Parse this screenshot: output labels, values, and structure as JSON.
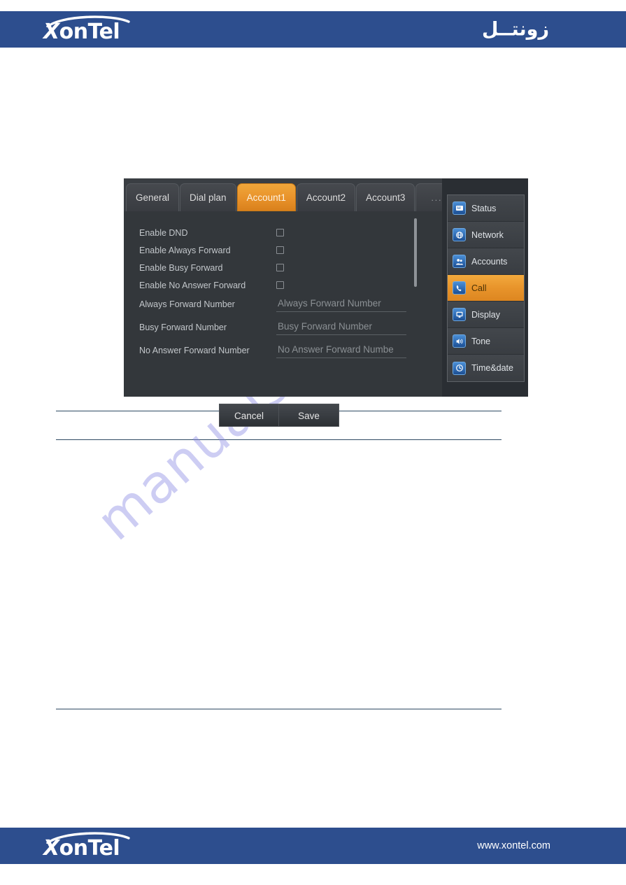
{
  "header": {
    "logo_text_x": "X",
    "logo_text_rest": "onTel",
    "arabic_brand": "زونتــل"
  },
  "footer": {
    "logo_text_x": "X",
    "logo_text_rest": "onTel",
    "url": "www.xontel.com"
  },
  "watermark": {
    "text": "manualshive.com"
  },
  "device_screenshot": {
    "tabs": [
      {
        "label": "General",
        "selected": false
      },
      {
        "label": "Dial plan",
        "selected": false
      },
      {
        "label": "Account1",
        "selected": true
      },
      {
        "label": "Account2",
        "selected": false
      },
      {
        "label": "Account3",
        "selected": false
      },
      {
        "label": "...",
        "selected": false
      }
    ],
    "checkbox_rows": [
      {
        "label": "Enable DND",
        "checked": false
      },
      {
        "label": "Enable Always Forward",
        "checked": false
      },
      {
        "label": "Enable Busy Forward",
        "checked": false
      },
      {
        "label": "Enable No Answer Forward",
        "checked": false
      }
    ],
    "input_rows": [
      {
        "label": "Always Forward Number",
        "placeholder": "Always Forward Number",
        "value": ""
      },
      {
        "label": "Busy Forward Number",
        "placeholder": "Busy Forward Number",
        "value": ""
      },
      {
        "label": "No Answer Forward Number",
        "placeholder": "No Answer Forward Numbe",
        "value": ""
      }
    ],
    "buttons": {
      "cancel": "Cancel",
      "save": "Save"
    },
    "menu_items": [
      {
        "label": "Status",
        "icon": "screen-icon",
        "glyph": "▤",
        "selected": false
      },
      {
        "label": "Network",
        "icon": "globe-icon",
        "glyph": "✲",
        "selected": false
      },
      {
        "label": "Accounts",
        "icon": "users-icon",
        "glyph": "☺",
        "selected": false
      },
      {
        "label": "Call",
        "icon": "phone-icon",
        "glyph": "✆",
        "selected": true
      },
      {
        "label": "Display",
        "icon": "monitor-icon",
        "glyph": "▢",
        "selected": false
      },
      {
        "label": "Tone",
        "icon": "speaker-icon",
        "glyph": "◂",
        "selected": false
      },
      {
        "label": "Time&date",
        "icon": "clock-icon",
        "glyph": "○",
        "selected": false
      }
    ],
    "colors": {
      "accent_orange": "#e8942b",
      "panel_dark": "#33373b",
      "brand_blue": "#2d4e8e"
    }
  }
}
